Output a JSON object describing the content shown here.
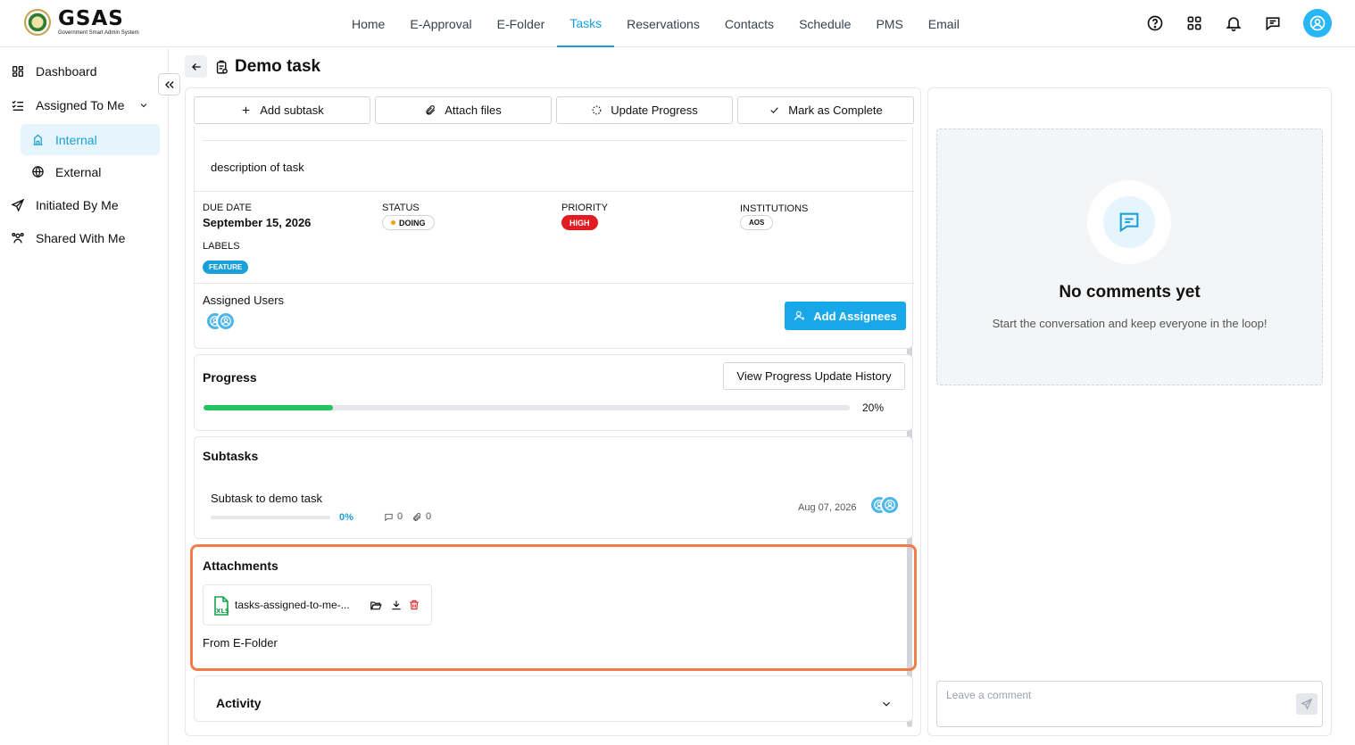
{
  "app": {
    "logo_name": "GSAS",
    "logo_sub": "Government Smart Admin System"
  },
  "nav": {
    "items": [
      "Home",
      "E-Approval",
      "E-Folder",
      "Tasks",
      "Reservations",
      "Contacts",
      "Schedule",
      "PMS",
      "Email"
    ],
    "active": "Tasks"
  },
  "sidebar": {
    "dashboard": "Dashboard",
    "assigned_to_me": "Assigned To Me",
    "internal": "Internal",
    "external": "External",
    "initiated_by_me": "Initiated By Me",
    "shared_with_me": "Shared With Me"
  },
  "page": {
    "title": "Demo task"
  },
  "actions": {
    "add_subtask": "Add subtask",
    "attach_files": "Attach files",
    "update_progress": "Update Progress",
    "mark_complete": "Mark as Complete"
  },
  "details": {
    "description": "description of task",
    "due_date_label": "DUE DATE",
    "due_date": "September 15, 2026",
    "status_label": "STATUS",
    "status": "DOING",
    "priority_label": "PRIORITY",
    "priority": "HIGH",
    "institutions_label": "INSTITUTIONS",
    "institution": "AOS",
    "labels_label": "LABELS",
    "label": "FEATURE",
    "assigned_users_label": "Assigned Users",
    "add_assignees": "Add Assignees"
  },
  "progress": {
    "title": "Progress",
    "history_button": "View Progress Update History",
    "percent_text": "20%",
    "value": 0.2
  },
  "subtasks": {
    "title": "Subtasks",
    "items": [
      {
        "name": "Subtask to demo task",
        "percent": "0%",
        "comments": "0",
        "attachments": "0",
        "date": "Aug 07, 2026"
      }
    ]
  },
  "attachments": {
    "title": "Attachments",
    "file_name": "tasks-assigned-to-me-...",
    "file_type": "XLS",
    "from_efolder": "From E-Folder"
  },
  "activity": {
    "title": "Activity"
  },
  "comments": {
    "empty_title": "No comments yet",
    "empty_sub": "Start the conversation and keep everyone in the loop!",
    "placeholder": "Leave a comment"
  },
  "colors": {
    "accent": "#1aa0d8",
    "priority_high": "#e11d24",
    "progress": "#22c55e",
    "highlight": "#f27c4a",
    "status_dot": "#f59e0b"
  }
}
